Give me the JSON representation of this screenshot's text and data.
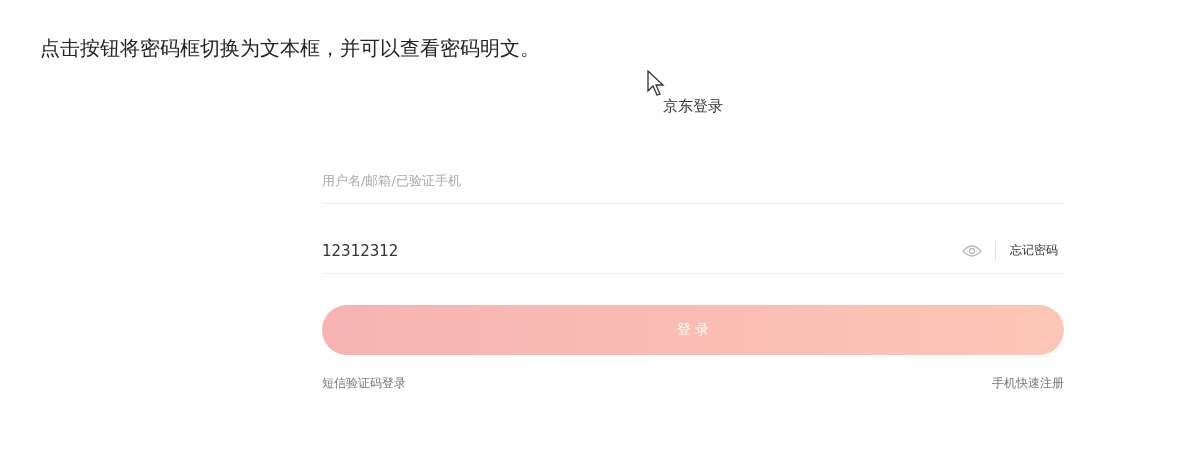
{
  "instruction": "点击按钮将密码框切换为文本框，并可以查看密码明文。",
  "login": {
    "title": "京东登录",
    "username": {
      "placeholder": "用户名/邮箱/已验证手机"
    },
    "password": {
      "value": "12312312",
      "visible": true
    },
    "forgot_link": "忘记密码",
    "submit": "登 录",
    "sms_link": "短信验证码登录",
    "register_link": "手机快速注册"
  }
}
